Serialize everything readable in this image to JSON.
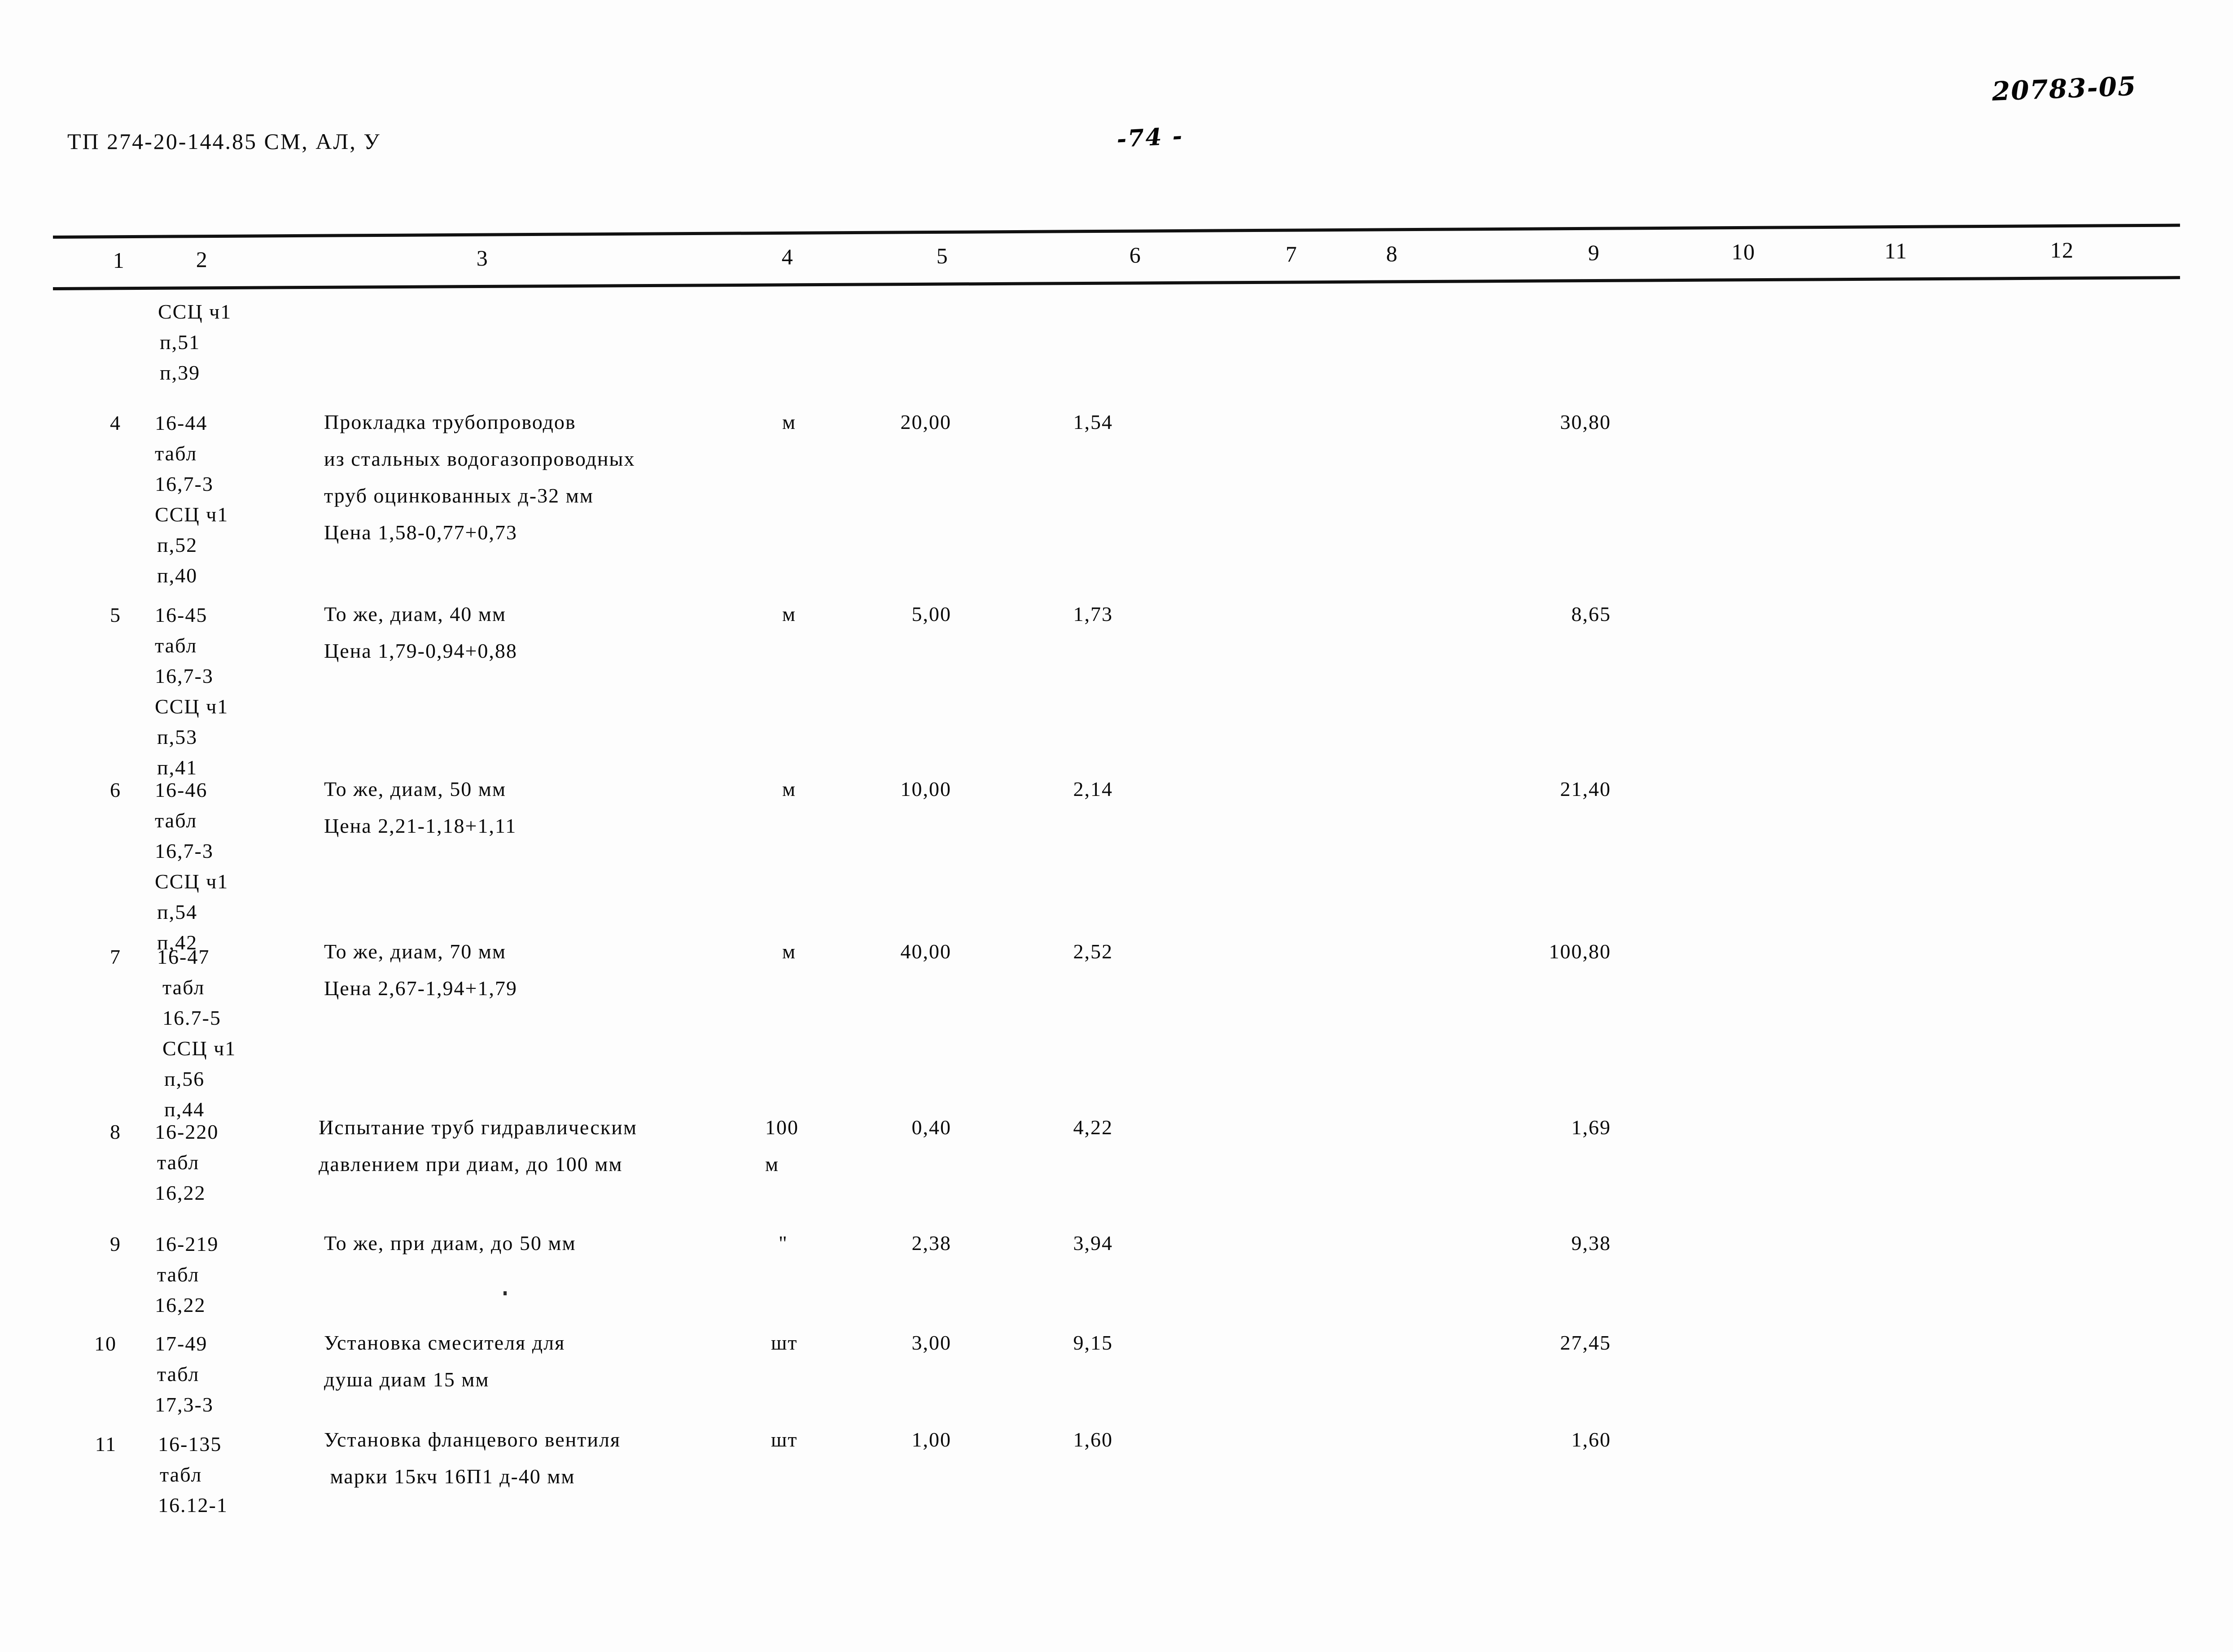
{
  "page": {
    "document_code": "ТП 274-20-144.85 СМ, АЛ, У",
    "page_number": "-74 -",
    "archive_code": "20783-05"
  },
  "table": {
    "column_headers": [
      "1",
      "2",
      "3",
      "4",
      "5",
      "6",
      "7",
      "8",
      "9",
      "10",
      "11",
      "12"
    ],
    "preamble": {
      "lines": [
        "ССЦ ч1",
        "п,51",
        "п,39"
      ]
    },
    "rows": [
      {
        "index": "4",
        "code_lines": [
          "16-44",
          "табл",
          "16,7-3",
          "ССЦ ч1",
          "п,52",
          "п,40"
        ],
        "description_lines": [
          "Прокладка трубопроводов",
          "из стальных водогазопроводных",
          "труб оцинкованных д-32 мм",
          "Цена 1,58-0,77+0,73"
        ],
        "unit_lines": [
          "м"
        ],
        "qty": "20,00",
        "price": "1,54",
        "col6": "",
        "col7": "",
        "col8": "",
        "total": "30,80",
        "col10": "",
        "col11": "",
        "col12": ""
      },
      {
        "index": "5",
        "code_lines": [
          "16-45",
          "табл",
          "16,7-3",
          "ССЦ ч1",
          "п,53",
          "п,41"
        ],
        "description_lines": [
          "То же, диам, 40 мм",
          "Цена 1,79-0,94+0,88"
        ],
        "unit_lines": [
          "м"
        ],
        "qty": "5,00",
        "price": "1,73",
        "col6": "",
        "col7": "",
        "col8": "",
        "total": "8,65",
        "col10": "",
        "col11": "",
        "col12": ""
      },
      {
        "index": "6",
        "code_lines": [
          "16-46",
          "табл",
          "16,7-3",
          "ССЦ ч1",
          "п,54",
          "п,42"
        ],
        "description_lines": [
          "То же, диам, 50 мм",
          "Цена 2,21-1,18+1,11"
        ],
        "unit_lines": [
          "м"
        ],
        "qty": "10,00",
        "price": "2,14",
        "col6": "",
        "col7": "",
        "col8": "",
        "total": "21,40",
        "col10": "",
        "col11": "",
        "col12": ""
      },
      {
        "index": "7",
        "code_lines": [
          "16-47",
          "табл",
          "16.7-5",
          "ССЦ ч1",
          "п,56",
          "п,44"
        ],
        "description_lines": [
          "То же, диам, 70 мм",
          "Цена 2,67-1,94+1,79"
        ],
        "unit_lines": [
          "м"
        ],
        "qty": "40,00",
        "price": "2,52",
        "col6": "",
        "col7": "",
        "col8": "",
        "total": "100,80",
        "col10": "",
        "col11": "",
        "col12": ""
      },
      {
        "index": "8",
        "code_lines": [
          "16-220",
          "табл",
          "16,22"
        ],
        "description_lines": [
          "Испытание труб гидравлическим",
          "давлением при диам, до 100 мм"
        ],
        "unit_lines": [
          "100",
          "м"
        ],
        "qty": "0,40",
        "price": "4,22",
        "col6": "",
        "col7": "",
        "col8": "",
        "total": "1,69",
        "col10": "",
        "col11": "",
        "col12": ""
      },
      {
        "index": "9",
        "code_lines": [
          "16-219",
          "табл",
          "16,22"
        ],
        "description_lines": [
          "То же, при диам, до 50 мм"
        ],
        "unit_lines": [
          "\""
        ],
        "qty": "2,38",
        "price": "3,94",
        "col6": "",
        "col7": "",
        "col8": "",
        "total": "9,38",
        "col10": "",
        "col11": "",
        "col12": ""
      },
      {
        "index": "10",
        "code_lines": [
          "17-49",
          "табл",
          "17,3-3"
        ],
        "description_lines": [
          "Установка смесителя для",
          "душа диам 15 мм"
        ],
        "unit_lines": [
          "шт"
        ],
        "qty": "3,00",
        "price": "9,15",
        "col6": "",
        "col7": "",
        "col8": "",
        "total": "27,45",
        "col10": "",
        "col11": "",
        "col12": ""
      },
      {
        "index": "11",
        "code_lines": [
          "16-135",
          "табл",
          "16.12-1"
        ],
        "description_lines": [
          "Установка фланцевого вентиля",
          " марки 15кч 16П1 д-40 мм"
        ],
        "unit_lines": [
          "шт"
        ],
        "qty": "1,00",
        "price": "1,60",
        "col6": "",
        "col7": "",
        "col8": "",
        "total": "1,60",
        "col10": "",
        "col11": "",
        "col12": ""
      }
    ]
  }
}
